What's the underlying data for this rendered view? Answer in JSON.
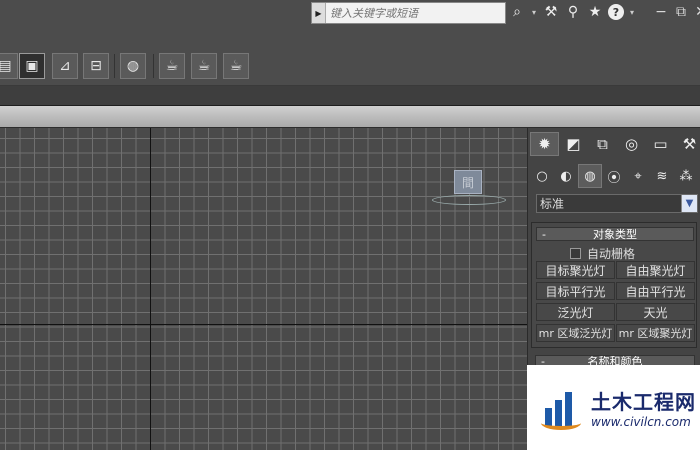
{
  "search": {
    "placeholder": "键入关键字或短语"
  },
  "window_controls": {
    "minimize": "−",
    "restore": "⧉",
    "close": "✕"
  },
  "search_tools": {
    "binoculars": "⌕",
    "dropdown": "▾",
    "wrench": "⚒",
    "satellite": "⚲",
    "star": "★",
    "help": "?",
    "help_dropdown": "▾"
  },
  "toolbar": {
    "items": [
      "▤",
      "▣",
      "⊿",
      "⊟",
      "◍",
      "☕",
      "☕",
      "☕"
    ]
  },
  "viewport": {
    "light_label": "間"
  },
  "command_panel": {
    "tabs": [
      "✹",
      "◩",
      "⧉",
      "◎",
      "▭",
      "⚒"
    ],
    "subtabs": [
      "○",
      "◐",
      "◍",
      "⦿",
      "⌖",
      "≋",
      "⁂"
    ],
    "category": "标准",
    "rollout_title": "对象类型",
    "autogrid_label": "自动栅格",
    "buttons": [
      "目标聚光灯",
      "自由聚光灯",
      "目标平行光",
      "自由平行光",
      "泛光灯",
      "天光",
      "mr 区域泛光灯",
      "mr 区域聚光灯"
    ],
    "rollout2_title": "名称和颜色",
    "collapse_symbol": "-"
  },
  "watermark": {
    "name": "土木工程网",
    "url": "www.civilcn.com"
  }
}
